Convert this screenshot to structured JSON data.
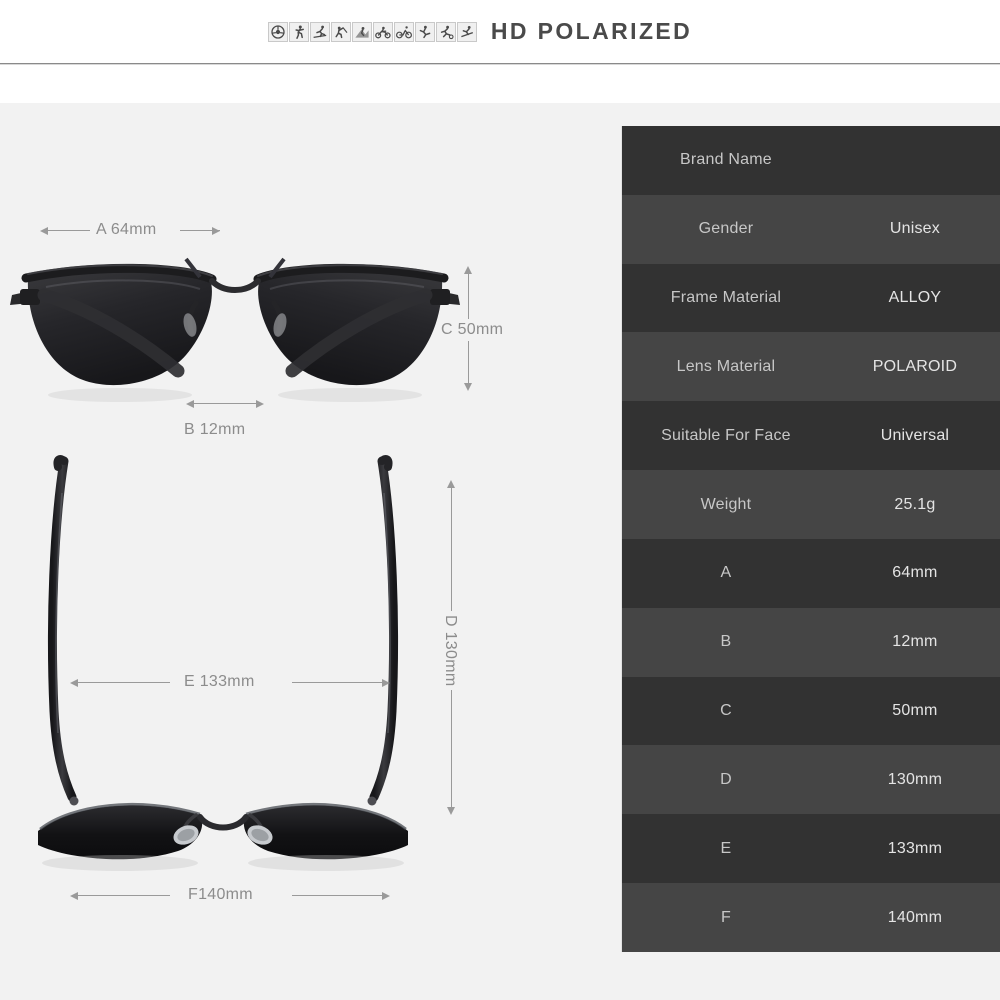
{
  "header": {
    "tagline": "HD POLARIZED",
    "icons": [
      "driving-icon",
      "running-icon",
      "skiing-icon",
      "fishing-icon",
      "climbing-icon",
      "motorcycling-icon",
      "cycling-icon",
      "skating-icon",
      "soccer-icon",
      "snowboarding-icon"
    ]
  },
  "diagram": {
    "front_view_alt": "Aviator sunglasses front view",
    "top_view_alt": "Aviator sunglasses top-down view",
    "measurements": {
      "a": "A 64mm",
      "b": "B 12mm",
      "c": "C 50mm",
      "d": "D 130mm",
      "e": "E 133mm",
      "f": "F140mm"
    }
  },
  "spec_table": {
    "rows": [
      {
        "key": "Brand Name",
        "value": ""
      },
      {
        "key": "Gender",
        "value": "Unisex"
      },
      {
        "key": "Frame Material",
        "value": "ALLOY"
      },
      {
        "key": "Lens Material",
        "value": "POLAROID"
      },
      {
        "key": "Suitable For Face",
        "value": "Universal"
      },
      {
        "key": "Weight",
        "value": "25.1g"
      },
      {
        "key": "A",
        "value": "64mm"
      },
      {
        "key": "B",
        "value": "12mm"
      },
      {
        "key": "C",
        "value": "50mm"
      },
      {
        "key": "D",
        "value": "130mm"
      },
      {
        "key": "E",
        "value": "133mm"
      },
      {
        "key": "F",
        "value": "140mm"
      }
    ]
  },
  "colors": {
    "page_background": "#f2f2f2",
    "header_background": "#ffffff",
    "row_dark": "#323232",
    "row_light": "#454545",
    "tagline_text": "#4a4a4a",
    "dimension_text": "#8c8c8c"
  }
}
